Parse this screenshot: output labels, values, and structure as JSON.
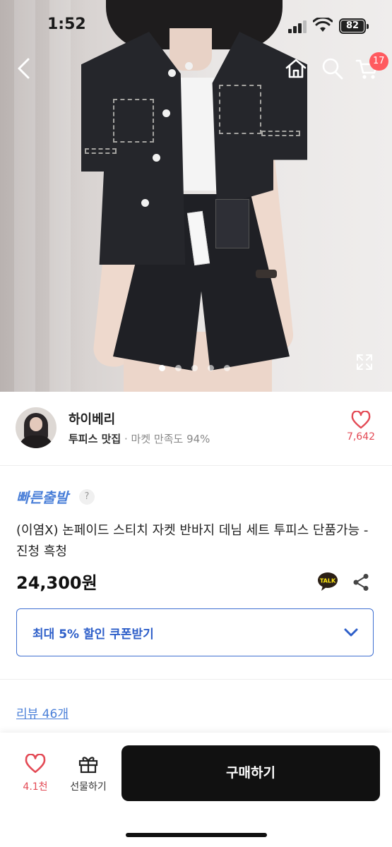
{
  "status_bar": {
    "time": "1:52",
    "battery": "82"
  },
  "nav": {
    "cart_count": "17"
  },
  "gallery": {
    "dot_count": 5,
    "active_dot": 0
  },
  "seller": {
    "name": "하이베리",
    "tag": "투피스 맛집",
    "satisfaction": "· 마켓 만족도 94%",
    "likes": "7,642"
  },
  "product": {
    "fast_shipping": "빠른출발",
    "help": "?",
    "title": "(이염X) 논페이드 스티치 자켓 반바지 데님 세트 투피스 단품가능 - 진청 흑청",
    "price": "24,300원",
    "kakao_badge": "TALK"
  },
  "coupon": {
    "label": "최대 5% 할인 쿠폰받기"
  },
  "reviews": {
    "link": "리뷰 46개"
  },
  "bottom_bar": {
    "like_count": "4.1천",
    "gift_label": "선물하기",
    "buy_label": "구매하기"
  },
  "colors": {
    "accent_blue": "#3f6fd1",
    "like_red": "#e34a55",
    "buy_black": "#111111"
  }
}
